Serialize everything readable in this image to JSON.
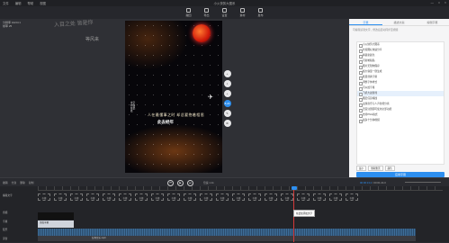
{
  "window": {
    "title": "小火快剪大图系",
    "menu": [
      "文件",
      "编辑",
      "帮助",
      "视图"
    ],
    "controls": [
      "—",
      "□",
      "×"
    ]
  },
  "toolbar": {
    "items": [
      {
        "label": "撤回",
        "icon": "undo-icon"
      },
      {
        "label": "导出",
        "icon": "export-icon"
      },
      {
        "label": "设置",
        "icon": "settings-icon"
      },
      {
        "label": "素材",
        "icon": "material-icon"
      },
      {
        "label": "发布",
        "icon": "publish-icon"
      }
    ]
  },
  "canvas": {
    "resolution_lines": [
      "分辨率 1024×1",
      "帧率 25"
    ],
    "decor_text": "入目之处 皆是你",
    "decor_text2": "等风来"
  },
  "poster": {
    "line1": "人在最懂事之时 却总要抱着相思",
    "line2": "此去经年",
    "line3": "文字内容在此处"
  },
  "float_tools": [
    "+",
    "×",
    "+",
    "8.24",
    "✎",
    "⚙"
  ],
  "right_panel": {
    "tabs": [
      "字幕",
      "描述文案",
      "编辑字幕"
    ],
    "active_tab": 0,
    "hint": "可编辑识别文字，修改后自动同步至视频",
    "items": [
      "小火快剪大图系",
      "长按图标快速分享",
      "解锁新颜色",
      "可复制粘贴",
      "图片无限制保存",
      "超大容量一键生成",
      "批量替换字幕",
      "调整字体样式",
      "可以加字幕",
      "飞机大战游戏",
      "图层任意拖拽",
      "主题音乐与人声智能分离",
      "无需注册即可使用全部功能",
      "支持PNG格式",
      "最多十分钟视频"
    ],
    "selected_index": 9,
    "format": {
      "size": "最小",
      "font": "微软雅黑",
      "color_label": "颜色"
    },
    "apply_button": "应用字幕"
  },
  "playbar": {
    "left_items": [
      "撤销",
      "分割",
      "删除",
      "复制"
    ],
    "controls": [
      "⏮",
      "▶",
      "⏭"
    ],
    "speed": "倍速 1.0x",
    "time_current": "00:00:13.2",
    "time_total": "00:01:24.0"
  },
  "timeline": {
    "track_labels": [
      "编辑文字",
      "",
      "音频",
      "字幕",
      "配乐",
      "录音"
    ],
    "clip_labels": [
      "字幕",
      "字幕",
      "字幕",
      "字幕",
      "字幕",
      "字幕",
      "字幕",
      "字幕",
      "字幕",
      "字幕",
      "字幕",
      "字幕",
      "字幕",
      "字幕",
      "字幕",
      "字幕",
      "字幕",
      "字幕",
      "字幕",
      "字幕"
    ],
    "subtitle_clip": "添加字幕",
    "music_label": "背景音乐.mp3",
    "tooltip": "在此处添加文字"
  },
  "colors": {
    "accent": "#2d8ff0",
    "playhead": "#d43a3a"
  }
}
